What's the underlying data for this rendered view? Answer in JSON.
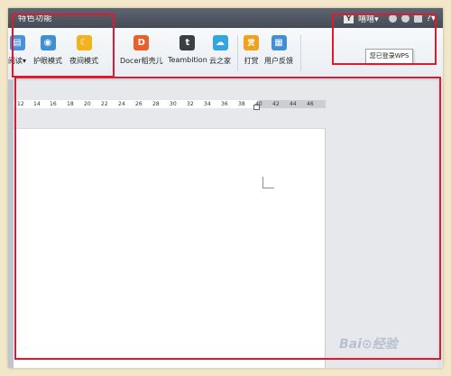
{
  "tabbar": {
    "active_tab": "特色功能",
    "avatar_letter": "Y",
    "user_name": "嘻嘻▾",
    "help": "?▾"
  },
  "ribbon": {
    "groups": [
      {
        "items": [
          {
            "label": "阅读▾",
            "icon": "read-icon",
            "color": "#4a90d9",
            "glyph": "▤"
          },
          {
            "label": "护眼模式",
            "icon": "eye-protect-icon",
            "color": "#3d8fd6",
            "glyph": "◉"
          },
          {
            "label": "夜间模式",
            "icon": "night-moon-icon",
            "color": "#f2b31c",
            "glyph": "☾"
          }
        ]
      },
      {
        "items": [
          {
            "label": "Docer稻壳儿",
            "icon": "docer-icon",
            "color": "#e8602a",
            "glyph": "D"
          },
          {
            "label": "Teambition",
            "icon": "teambition-icon",
            "color": "#3a3f46",
            "glyph": "t"
          },
          {
            "label": "云之家",
            "icon": "cloud-home-icon",
            "color": "#33a6e0",
            "glyph": "☁"
          }
        ]
      },
      {
        "items": [
          {
            "label": "打赏",
            "icon": "reward-icon",
            "color": "#f0a21e",
            "glyph": "赏"
          },
          {
            "label": "用户反馈",
            "icon": "feedback-icon",
            "color": "#3e8ed8",
            "glyph": "▦"
          }
        ]
      }
    ]
  },
  "tooltip": "您已登录WPS",
  "ruler": {
    "ticks": [
      "12",
      "14",
      "16",
      "18",
      "20",
      "22",
      "24",
      "26",
      "28",
      "30",
      "32",
      "34",
      "36",
      "38",
      "40",
      "42",
      "44",
      "46"
    ]
  },
  "watermark": "Bai⊙经验"
}
